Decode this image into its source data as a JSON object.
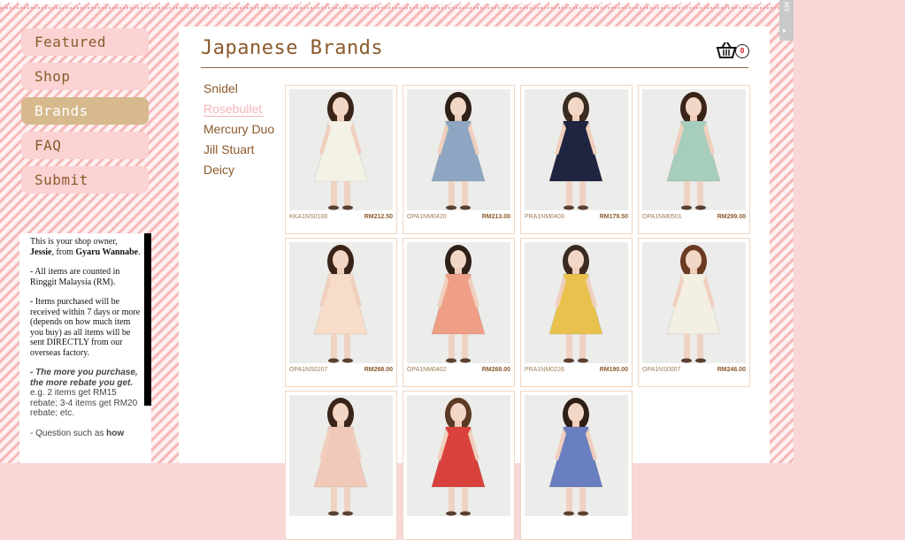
{
  "side_tab": {
    "label": "MY",
    "arrow": "▸"
  },
  "nav": [
    {
      "label": "Featured",
      "active": false
    },
    {
      "label": "Shop",
      "active": false
    },
    {
      "label": "Brands",
      "active": true
    },
    {
      "label": "FAQ",
      "active": false
    },
    {
      "label": "Submit",
      "active": false
    }
  ],
  "owner": {
    "p1_a": "This is your shop owner, ",
    "p1_name": "Jessie",
    "p1_b": ", from ",
    "p1_shop": "Gyaru Wannabe",
    "p1_c": ".",
    "p2": "- All items are counted in Ringgit Malaysia (RM).",
    "p3": "- Items purchased will be received within 7 days or more (depends on how much item you buy) as all items will be sent DIRECTLY from our overseas factory.",
    "p4_bold": "- The more you purchase, the more rebate you get.",
    "p4_rest": "e.g. 2 items get RM15 rebate; 3-4 items get RM20 rebate; etc.",
    "p5_a": "- Question such as ",
    "p5_b": "how"
  },
  "page_title": "Japanese Brands",
  "cart": {
    "count": "0",
    "icon": "basket-icon"
  },
  "brands": [
    {
      "label": "Snidel",
      "active": false
    },
    {
      "label": "Rosebullet",
      "active": true
    },
    {
      "label": "Mercury Duo",
      "active": false
    },
    {
      "label": "Jill Stuart",
      "active": false
    },
    {
      "label": "Deicy",
      "active": false
    }
  ],
  "products": [
    {
      "code": "KKA1NS0108",
      "price": "RM212.50",
      "dress": "#f4f1e6",
      "hair": "#3a2418"
    },
    {
      "code": "OPA1NM0420",
      "price": "RM213.00",
      "dress": "#8fa6c2",
      "hair": "#2e1f17"
    },
    {
      "code": "PRA1NM0403",
      "price": "RM179.50",
      "dress": "#1f2440",
      "hair": "#3a2a20"
    },
    {
      "code": "OPA1NM0501",
      "price": "RM299.00",
      "dress": "#a7cdbd",
      "hair": "#3a2418"
    },
    {
      "code": "OPA1NS0207",
      "price": "RM268.00",
      "dress": "#f7dcc9",
      "hair": "#3a2418"
    },
    {
      "code": "OPA1NM0402",
      "price": "RM268.00",
      "dress": "#ef9f86",
      "hair": "#2e1f17"
    },
    {
      "code": "PRA1NM0226",
      "price": "RM190.00",
      "dress": "#e9c24e",
      "hair": "#3a2a20"
    },
    {
      "code": "OPA1NS0007",
      "price": "RM246.00",
      "dress": "#f3efe2",
      "hair": "#6b3a22"
    },
    {
      "code": "",
      "price": "",
      "dress": "#f0c9b8",
      "hair": "#3a2418"
    },
    {
      "code": "",
      "price": "",
      "dress": "#d9423c",
      "hair": "#5a3a24"
    },
    {
      "code": "",
      "price": "",
      "dress": "#6a7fbf",
      "hair": "#2e1f17"
    }
  ]
}
